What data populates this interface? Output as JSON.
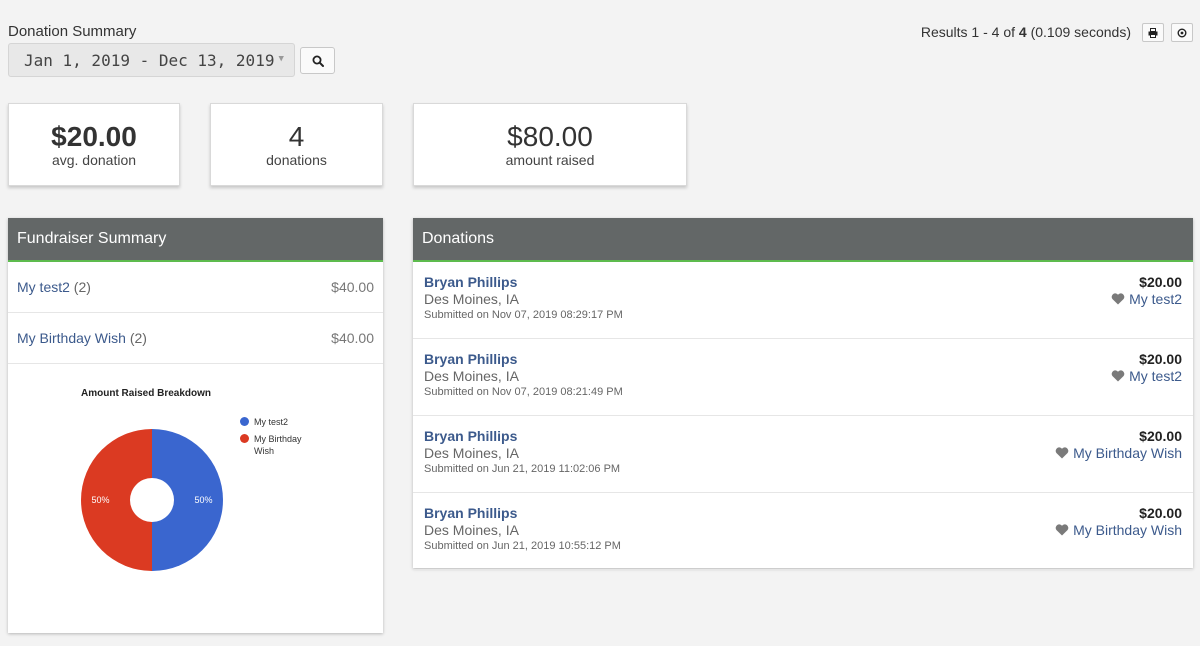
{
  "header": {
    "title": "Donation Summary",
    "date_range": "Jan 1, 2019 - Dec 13, 2019",
    "results_prefix": "Results 1 - 4 of ",
    "results_total": "4",
    "results_suffix": " (0.109 seconds)",
    "icons": [
      "print-icon",
      "settings-icon",
      "search-icon"
    ]
  },
  "stats": [
    {
      "value": "$20.00",
      "label": "avg. donation"
    },
    {
      "value": "4",
      "label": "donations"
    },
    {
      "value": "$80.00",
      "label": "amount raised"
    }
  ],
  "fundraiser_summary": {
    "title": "Fundraiser Summary",
    "items": [
      {
        "name": "My test2",
        "count": "(2)",
        "amount": "$40.00"
      },
      {
        "name": "My Birthday Wish",
        "count": "(2)",
        "amount": "$40.00"
      }
    ]
  },
  "chart_data": {
    "type": "pie",
    "title": "Amount Raised Breakdown",
    "categories": [
      "My test2",
      "My Birthday Wish"
    ],
    "values": [
      50,
      50
    ],
    "value_labels": [
      "50%",
      "50%"
    ],
    "colors": [
      "#3a66cf",
      "#db3a22"
    ],
    "legend": "right"
  },
  "donations": {
    "title": "Donations",
    "items": [
      {
        "name": "Bryan Phillips",
        "location": "Des Moines, IA",
        "submitted": "Submitted on Nov 07, 2019 08:29:17 PM",
        "amount": "$20.00",
        "fund": "My test2"
      },
      {
        "name": "Bryan Phillips",
        "location": "Des Moines, IA",
        "submitted": "Submitted on Nov 07, 2019 08:21:49 PM",
        "amount": "$20.00",
        "fund": "My test2"
      },
      {
        "name": "Bryan Phillips",
        "location": "Des Moines, IA",
        "submitted": "Submitted on Jun 21, 2019 11:02:06 PM",
        "amount": "$20.00",
        "fund": "My Birthday Wish"
      },
      {
        "name": "Bryan Phillips",
        "location": "Des Moines, IA",
        "submitted": "Submitted on Jun 21, 2019 10:55:12 PM",
        "amount": "$20.00",
        "fund": "My Birthday Wish"
      }
    ]
  },
  "colors": {
    "panel_header": "#636767",
    "accent_line": "#5dbb4e",
    "link": "#3c5a8c"
  }
}
